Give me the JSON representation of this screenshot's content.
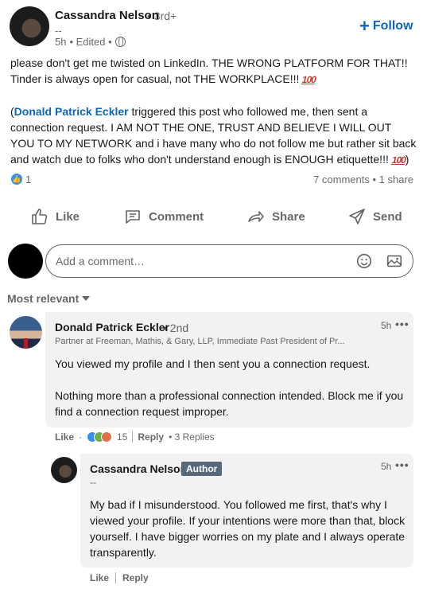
{
  "post": {
    "author_name": "Cassandra Nelson",
    "author_degree": "• 3rd+",
    "author_headline": "--",
    "time": "5h",
    "edited": "• Edited •",
    "follow_label": "Follow",
    "body_line1": "please don't get me twisted on LinkedIn. THE WRONG PLATFORM FOR THAT!! Tinder is always open for casual, not THE WORKPLACE!!!",
    "body_p2_open": "(",
    "mention": "Donald Patrick Eckler",
    "body_p2_rest": " triggered this post who followed me, then sent a connection request. I AM NOT THE ONE, TRUST AND BELIEVE I WILL OUT YOU TO MY NETWORK and i have many who do not follow me but rather sit back and watch due to folks who don't understand enough is ENOUGH etiquette!!!",
    "body_p2_close": ")",
    "emoji_100": "100",
    "reaction_count": "1",
    "comments_shares": "7 comments • 1 share"
  },
  "actions": {
    "like": "Like",
    "comment": "Comment",
    "share": "Share",
    "send": "Send"
  },
  "composer": {
    "placeholder": "Add a comment…"
  },
  "sort_label": "Most relevant",
  "comments": [
    {
      "name": "Donald Patrick Eckler",
      "degree": "• 2nd",
      "headline": "Partner at Freeman, Mathis, & Gary, LLP, Immediate Past President of Pr...",
      "time": "5h",
      "more": "•••",
      "text_p1": "You viewed my profile and I then sent you a connection request.",
      "text_p2": "Nothing more than a professional connection intended. Block me if you find a connection request improper.",
      "like_label": "Like",
      "reaction_count": "15",
      "reply_label": "Reply",
      "replies_label": "• 3 Replies"
    },
    {
      "name": "Cassandra Nelson",
      "badge": "Author",
      "headline": "--",
      "time": "5h",
      "more": "•••",
      "text": "My bad if I misunderstood. You followed me first, that's why I viewed your profile. If your intentions were more than that, block yourself. I have bigger worries on my plate and I always operate transparently.",
      "like_label": "Like",
      "reply_label": "Reply"
    }
  ],
  "colors": {
    "brand_blue": "#0a66c2",
    "like_blue": "#378fe9",
    "bubble_bg": "#f2f2f2",
    "badge_bg": "#56687a"
  }
}
